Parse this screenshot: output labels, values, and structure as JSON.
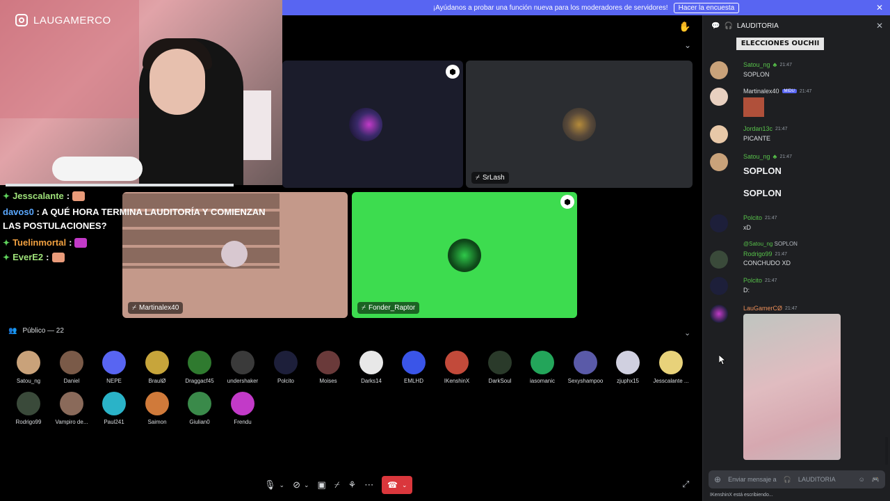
{
  "banner": {
    "text": "¡Ayúdanos a probar una función nueva para los moderadores de servidores!",
    "button": "Hacer la encuesta",
    "close": "✕"
  },
  "webcam": {
    "handle": "LAUGAMERCO"
  },
  "tiles": [
    {
      "label": "",
      "bg": "#1b1c2b"
    },
    {
      "label": "SrLash",
      "bg": "#2b2d31"
    },
    {
      "label": "Martinalex40",
      "bg": "#c4998a"
    },
    {
      "label": "Fonder_Raptor",
      "bg": "#3ddc4f"
    }
  ],
  "overlay": {
    "lines": [
      {
        "user": "Jesscalante",
        "sep": ":"
      },
      {
        "user": "davos0",
        "sep": ":",
        "text": "A QUÉ HORA TERMINA LAUDITORÍA Y COMIENZAN LAS POSTULACIONES?"
      },
      {
        "user": "Tuelinmortal",
        "sep": ":"
      },
      {
        "user": "EverE2",
        "sep": ":"
      }
    ]
  },
  "audience": {
    "title": "Público — 22",
    "people": [
      {
        "name": "Satou_ng",
        "color": "#c9a27a"
      },
      {
        "name": "Daniel",
        "color": "#7a5a48"
      },
      {
        "name": "NEPE",
        "color": "#5865f2"
      },
      {
        "name": "BraulØ",
        "color": "#c7a53b"
      },
      {
        "name": "Draggacf45",
        "color": "#2f7a2f"
      },
      {
        "name": "undershaker",
        "color": "#3a3a3a"
      },
      {
        "name": "Polcito",
        "color": "#1d1f3a"
      },
      {
        "name": "Moises",
        "color": "#6a3a3a"
      },
      {
        "name": "Darks14",
        "color": "#e8e8e8"
      },
      {
        "name": "EMLHD",
        "color": "#3a55e8"
      },
      {
        "name": "IKenshinX",
        "color": "#c24a3a"
      },
      {
        "name": "DarkSoul",
        "color": "#2a3a2a"
      },
      {
        "name": "iasomanic",
        "color": "#23a55a"
      },
      {
        "name": "Sexyshampoo",
        "color": "#5a5aa8"
      },
      {
        "name": "zjuphx15",
        "color": "#d0d0e0"
      },
      {
        "name": "Jesscalante ...",
        "color": "#e8d27a"
      },
      {
        "name": "Rodrigo99",
        "color": "#3a4a3a"
      },
      {
        "name": "Vampiro de...",
        "color": "#8a6a5a"
      },
      {
        "name": "Paul241",
        "color": "#2ab3c8"
      },
      {
        "name": "Saimon",
        "color": "#d07a3a"
      },
      {
        "name": "Giulian0",
        "color": "#3a8a4a"
      },
      {
        "name": "Frendu",
        "color": "#c23ac8"
      }
    ]
  },
  "chat": {
    "channel": "LAUDITORIA",
    "banner_img_text": "ELECCIONES OUCHII",
    "messages": [
      {
        "user": "Satou_ng",
        "time": "21:47",
        "text": "SOPLON"
      },
      {
        "user": "Martinalex40",
        "badge": "MIDU",
        "time": "21:47",
        "text": ""
      },
      {
        "user": "Jordan13c",
        "time": "21:47",
        "text": "PICANTE"
      },
      {
        "user": "Satou_ng",
        "time": "21:47",
        "text": "SOPLON",
        "text2": "SOPLON"
      },
      {
        "user": "Polcito",
        "time": "21:47",
        "text": "xD"
      },
      {
        "reply_to": "@Satou_ng",
        "reply_text": "SOPLON",
        "user": "Rodrigo99",
        "time": "21:47",
        "text": "CONCHUDO XD"
      },
      {
        "user": "Polcito",
        "time": "21:47",
        "text": "D:"
      },
      {
        "user": "LauGamerCØ",
        "time": "21:47",
        "text": ""
      }
    ],
    "input_placeholder": "Enviar mensaje a",
    "input_channel": "LAUDITORIA",
    "typing": "IKenshinX está escribiendo..."
  }
}
